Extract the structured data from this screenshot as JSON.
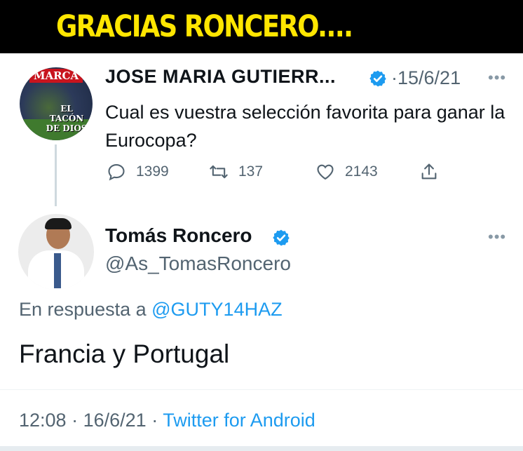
{
  "banner": {
    "title": "GRACIAS RONCERO...."
  },
  "original_tweet": {
    "avatar_text": {
      "masthead": "MARCA",
      "caption": "EL TACÓN DE DIOS"
    },
    "author_name": "JOSE MARIA GUTIERR...",
    "separator": "·",
    "date": "15/6/21",
    "more_icon": "more-horizontal-icon",
    "text": "Cual es vuestra selección favorita para ganar la Eurocopa?",
    "actions": {
      "reply_count": "1399",
      "retweet_count": "137",
      "like_count": "2143"
    }
  },
  "reply_tweet": {
    "author_name": "Tomás Roncero",
    "handle": "@As_TomasRoncero",
    "reply_prefix": "En respuesta a",
    "reply_to_handle": "@GUTY14HAZ",
    "text": "Francia y Portugal",
    "time": "12:08",
    "date": "16/6/21",
    "source": "Twitter for Android"
  },
  "colors": {
    "banner_bg": "#000000",
    "banner_text": "#ffe600",
    "verified": "#1d9bf0",
    "link": "#1d9bf0",
    "secondary_text": "#536471"
  }
}
